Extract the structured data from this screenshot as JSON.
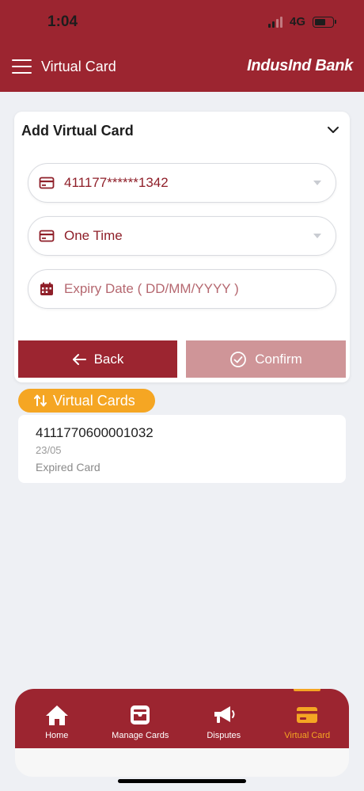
{
  "status": {
    "time": "1:04",
    "network": "4G"
  },
  "header": {
    "title": "Virtual Card",
    "logo": "IndusInd Bank"
  },
  "panel": {
    "title": "Add Virtual Card",
    "card_select_value": "411177******1342",
    "type_select_value": "One Time",
    "expiry_placeholder": "Expiry Date ( DD/MM/YYYY )",
    "back_label": "Back",
    "confirm_label": "Confirm"
  },
  "virtual_cards": {
    "badge_label": "Virtual Cards",
    "items": [
      {
        "number": "4111770600001032",
        "date": "23/05",
        "status": "Expired Card"
      }
    ]
  },
  "nav": {
    "items": [
      {
        "label": "Home",
        "icon": "home-icon"
      },
      {
        "label": "Manage Cards",
        "icon": "manage-cards-icon"
      },
      {
        "label": "Disputes",
        "icon": "megaphone-icon"
      },
      {
        "label": "Virtual Card",
        "icon": "virtual-card-icon"
      }
    ],
    "active": "Virtual Card"
  },
  "colors": {
    "brand": "#9c2530",
    "accent": "#f5a623",
    "confirm_disabled": "#cf9598",
    "background": "#eef0f4"
  }
}
